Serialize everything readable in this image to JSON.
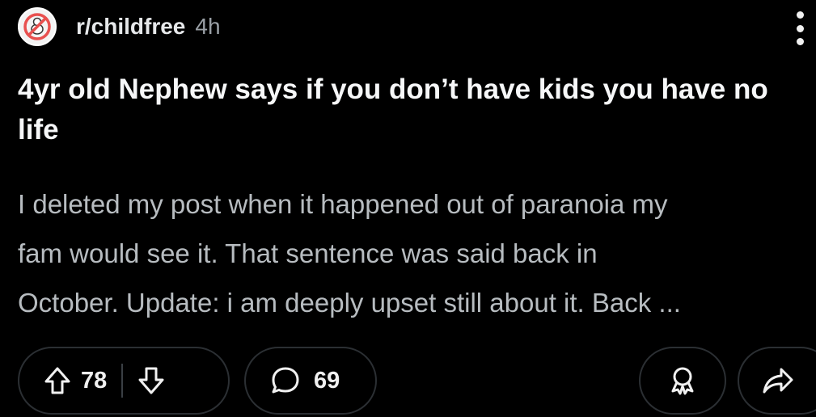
{
  "post": {
    "subreddit": "r/childfree",
    "age": "4h",
    "title": "4yr old Nephew says if you don’t have kids you have no life",
    "body_lines": [
      "I deleted my post when it happened out of paranoia my",
      "fam would see it. That sentence was said back in",
      "October. Update: i am deeply upset still about it. Back ..."
    ]
  },
  "actions": {
    "score": "78",
    "comments": "69"
  },
  "icons": {
    "avatar": "childfree-subreddit-avatar",
    "menu": "vertical-ellipsis-icon",
    "upvote": "upvote-arrow-icon",
    "downvote": "downvote-arrow-icon",
    "comment": "speech-bubble-icon",
    "award": "award-icon",
    "share": "share-arrow-icon"
  },
  "colors": {
    "background": "#000000",
    "title": "#f6f7f8",
    "body": "#b7bcc0",
    "muted": "#9aa0a6",
    "pill_border": "#2b2f33",
    "avatar_accent": "#e8504f"
  }
}
